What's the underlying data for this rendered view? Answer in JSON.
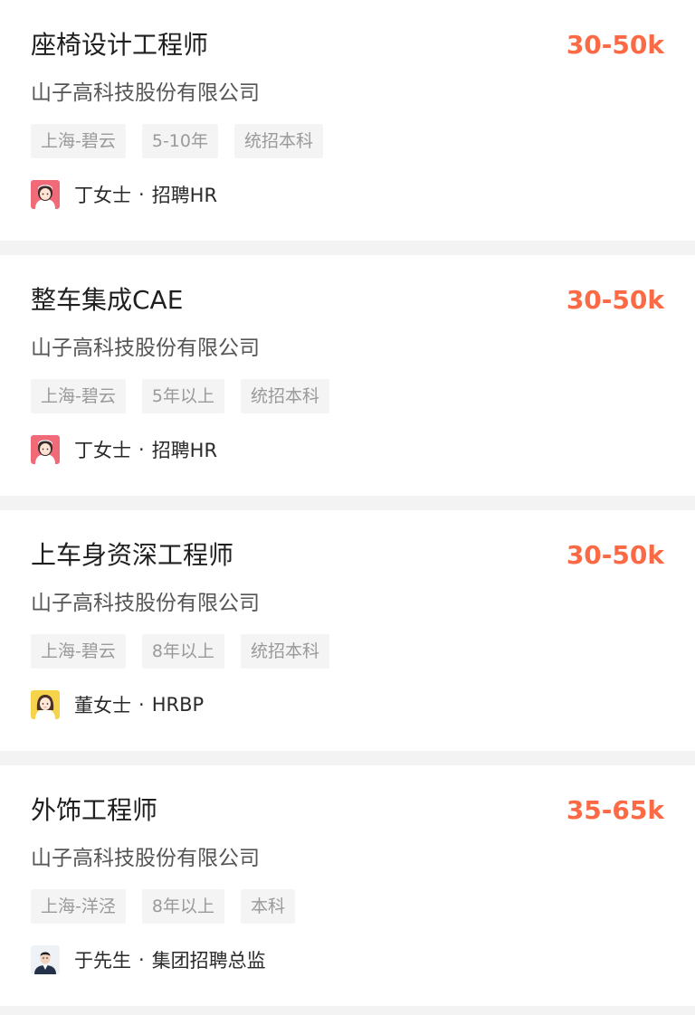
{
  "jobs": [
    {
      "title": "座椅设计工程师",
      "salary": "30-50k",
      "company": "山子高科技股份有限公司",
      "tags": [
        "上海-碧云",
        "5-10年",
        "统招本科"
      ],
      "recruiter": {
        "name": "丁女士",
        "separator": "·",
        "role": "招聘HR",
        "avatar_icon": "female-avatar-red-icon"
      }
    },
    {
      "title": "整车集成CAE",
      "salary": "30-50k",
      "company": "山子高科技股份有限公司",
      "tags": [
        "上海-碧云",
        "5年以上",
        "统招本科"
      ],
      "recruiter": {
        "name": "丁女士",
        "separator": "·",
        "role": "招聘HR",
        "avatar_icon": "female-avatar-red-icon"
      }
    },
    {
      "title": "上车身资深工程师",
      "salary": "30-50k",
      "company": "山子高科技股份有限公司",
      "tags": [
        "上海-碧云",
        "8年以上",
        "统招本科"
      ],
      "recruiter": {
        "name": "董女士",
        "separator": "·",
        "role": "HRBP",
        "avatar_icon": "female-avatar-yellow-icon"
      }
    },
    {
      "title": "外饰工程师",
      "salary": "35-65k",
      "company": "山子高科技股份有限公司",
      "tags": [
        "上海-洋泾",
        "8年以上",
        "本科"
      ],
      "recruiter": {
        "name": "于先生",
        "separator": "·",
        "role": "集团招聘总监",
        "avatar_icon": "male-avatar-photo-icon"
      }
    }
  ],
  "colors": {
    "salary": "#fb6a45",
    "tag_bg": "#f4f4f4",
    "tag_text": "#9a9a9a",
    "page_bg": "#f3f3f3"
  }
}
